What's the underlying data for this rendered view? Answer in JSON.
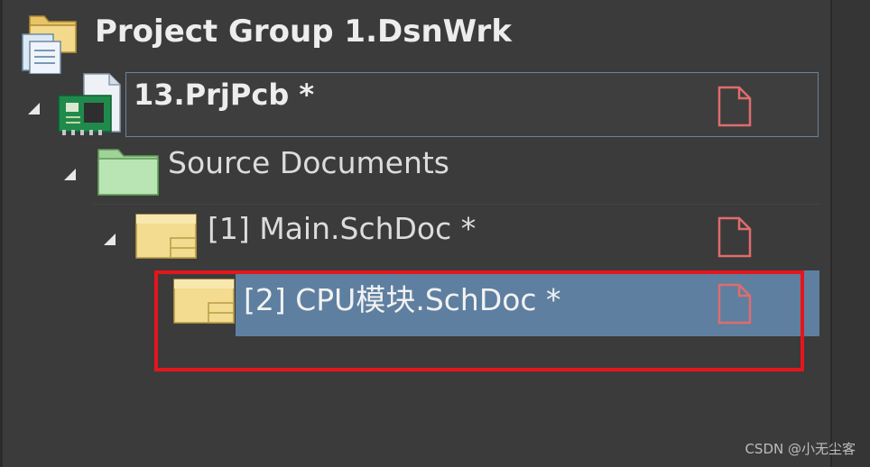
{
  "tree": {
    "group": {
      "label": "Project Group 1.DsnWrk",
      "icon": "project-group-icon"
    },
    "project": {
      "label": "13.PrjPcb *",
      "icon": "pcb-project-icon",
      "modified_icon": "document-modified-icon"
    },
    "folder": {
      "label": "Source Documents",
      "icon": "folder-icon"
    },
    "docs": [
      {
        "label": "[1] Main.SchDoc *",
        "icon": "schematic-doc-icon",
        "modified_icon": "document-modified-icon"
      },
      {
        "label": "[2] CPU模块.SchDoc *",
        "icon": "schematic-doc-icon",
        "modified_icon": "document-modified-icon"
      }
    ]
  },
  "colors": {
    "panel_bg": "#3b3b3b",
    "selection_bg": "#5e7fa0",
    "annotation_red": "#e4161c",
    "modified_icon": "#e06c6c"
  },
  "watermark": "CSDN @小无尘客"
}
